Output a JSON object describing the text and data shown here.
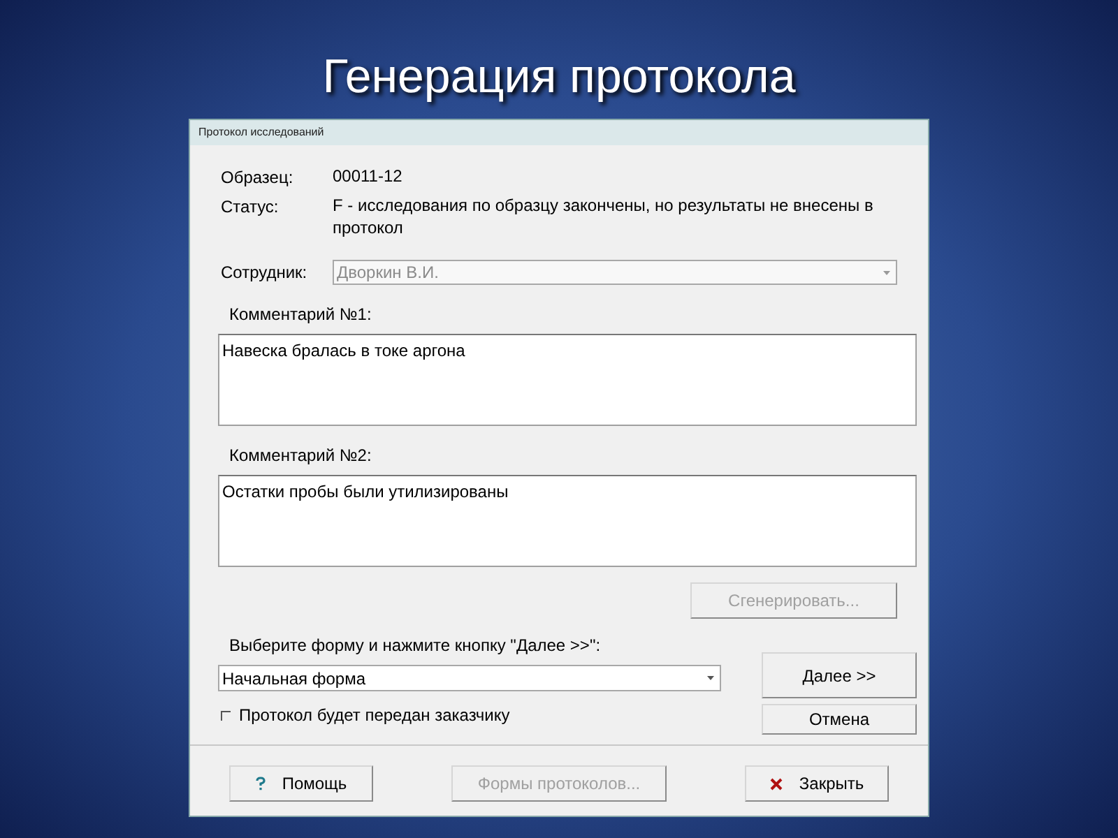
{
  "slide": {
    "title": "Генерация протокола"
  },
  "window": {
    "title": "Протокол исследований"
  },
  "fields": [
    {
      "label": "Образец:",
      "value": "00011-12"
    },
    {
      "label": "Статус:",
      "value": "F - исследования по образцу закончены, но результаты не внесены в протокол"
    }
  ],
  "employee": {
    "label": "Сотрудник:",
    "value": "Дворкин В.И.",
    "disabled": true
  },
  "comments": [
    {
      "label": "Комментарий №1:",
      "value": "Навеска бралась в токе аргона"
    },
    {
      "label": "Комментарий №2:",
      "value": "Остатки пробы были утилизированы"
    }
  ],
  "generate_button": {
    "label": "Сгенерировать...",
    "disabled": true
  },
  "form_select": {
    "label": "Выберите форму и нажмите кнопку \"Далее >>\":",
    "value": "Начальная форма"
  },
  "checkbox": {
    "label": "Протокол будет передан заказчику",
    "checked": false
  },
  "side_buttons": [
    {
      "label": "Далее >>",
      "disabled": false
    },
    {
      "label": "Отмена",
      "disabled": false
    }
  ],
  "footer_buttons": [
    {
      "kind": "help",
      "label": "Помощь",
      "disabled": false
    },
    {
      "kind": "plain",
      "label": "Формы протоколов...",
      "disabled": true
    },
    {
      "kind": "close",
      "label": "Закрыть",
      "disabled": false
    }
  ]
}
